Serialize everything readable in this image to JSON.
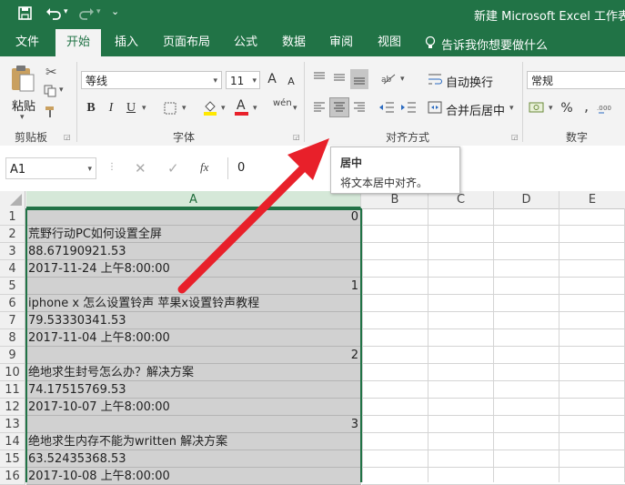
{
  "window": {
    "title": "新建 Microsoft Excel 工作表.x"
  },
  "tabs": [
    "文件",
    "开始",
    "插入",
    "页面布局",
    "公式",
    "数据",
    "审阅",
    "视图"
  ],
  "tell_me": "告诉我你想要做什么",
  "ribbon": {
    "paste_label": "粘贴",
    "clipboard_label": "剪贴板",
    "font_name": "等线",
    "font_size": "11",
    "bold": "B",
    "italic": "I",
    "underline": "U",
    "font_group_label": "字体",
    "wrap_text": "自动换行",
    "merge_center": "合并后居中",
    "alignment_label": "对齐方式",
    "number_format": "常规",
    "percent": "%",
    "number_label": "数字",
    "font_grow": "A",
    "font_shrink": "A",
    "font_color_letter": "A",
    "phonetic": "wén"
  },
  "formula_bar": {
    "name_box": "A1",
    "fx": "fx",
    "value": "0"
  },
  "tooltip": {
    "title": "居中",
    "body": "将文本居中对齐。"
  },
  "columns": [
    "A",
    "B",
    "C",
    "D",
    "E"
  ],
  "rows": [
    {
      "n": "1",
      "a": "0",
      "num": true
    },
    {
      "n": "2",
      "a": "荒野行动PC如何设置全屏",
      "num": false
    },
    {
      "n": "3",
      "a": "88.67190921.53",
      "num": false
    },
    {
      "n": "4",
      "a": "2017-11-24 上午8:00:00",
      "num": false
    },
    {
      "n": "5",
      "a": "1",
      "num": true
    },
    {
      "n": "6",
      "a": "iphone x 怎么设置铃声 苹果x设置铃声教程",
      "num": false
    },
    {
      "n": "7",
      "a": "79.53330341.53",
      "num": false
    },
    {
      "n": "8",
      "a": "2017-11-04 上午8:00:00",
      "num": false
    },
    {
      "n": "9",
      "a": "2",
      "num": true
    },
    {
      "n": "10",
      "a": "绝地求生封号怎么办？解决方案",
      "num": false
    },
    {
      "n": "11",
      "a": "74.17515769.53",
      "num": false
    },
    {
      "n": "12",
      "a": "2017-10-07 上午8:00:00",
      "num": false
    },
    {
      "n": "13",
      "a": "3",
      "num": true
    },
    {
      "n": "14",
      "a": "绝地求生内存不能为written 解决方案",
      "num": false
    },
    {
      "n": "15",
      "a": "63.52435368.53",
      "num": false
    },
    {
      "n": "16",
      "a": "2017-10-08 上午8:00:00",
      "num": false
    }
  ],
  "colors": {
    "excel_green": "#217346",
    "selection_fill": "#d1d1d1",
    "arrow": "#e8202a"
  }
}
